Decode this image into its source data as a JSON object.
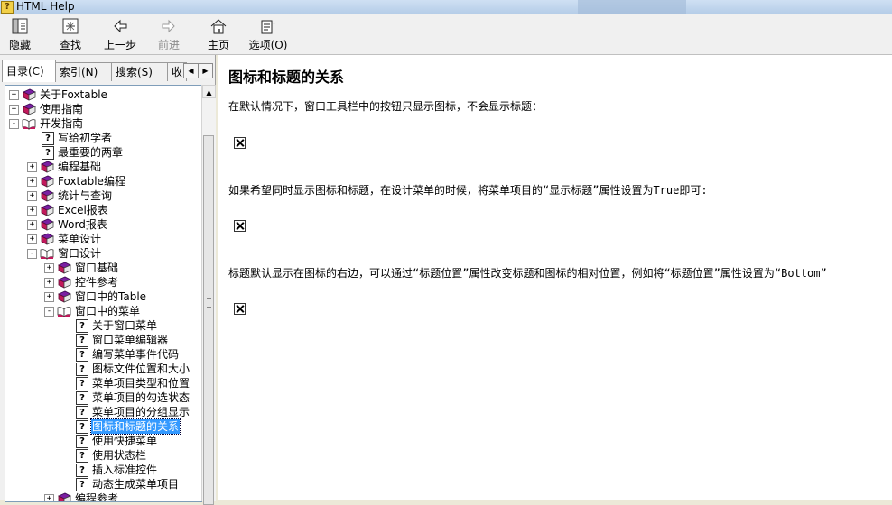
{
  "window": {
    "title": "HTML Help",
    "icon": "help-book-icon"
  },
  "toolbar": {
    "buttons": [
      {
        "label": "隐藏",
        "icon": "hide-pane-icon"
      },
      {
        "label": "查找",
        "icon": "locate-icon"
      },
      {
        "label": "上一步",
        "icon": "back-arrow-icon"
      },
      {
        "label": "前进",
        "icon": "forward-arrow-icon",
        "disabled": true
      },
      {
        "label": "主页",
        "icon": "home-icon"
      },
      {
        "label": "选项(O)",
        "icon": "options-icon"
      }
    ]
  },
  "tabs": [
    {
      "label": "目录(C)"
    },
    {
      "label": "索引(N)"
    },
    {
      "label": "搜索(S)"
    },
    {
      "label": "收"
    }
  ],
  "tree": [
    {
      "label": "关于Foxtable",
      "icon": "book-closed-icon",
      "expander": "+"
    },
    {
      "label": "使用指南",
      "icon": "book-closed-icon",
      "expander": "+"
    },
    {
      "label": "开发指南",
      "icon": "book-open-icon",
      "expander": "-"
    },
    {
      "label": "写给初学者",
      "icon": "topic-page-icon"
    },
    {
      "label": "最重要的两章",
      "icon": "topic-page-icon"
    },
    {
      "label": "编程基础",
      "icon": "book-closed-icon",
      "expander": "+"
    },
    {
      "label": "Foxtable编程",
      "icon": "book-closed-icon",
      "expander": "+"
    },
    {
      "label": "统计与查询",
      "icon": "book-closed-icon",
      "expander": "+"
    },
    {
      "label": "Excel报表",
      "icon": "book-closed-icon",
      "expander": "+"
    },
    {
      "label": "Word报表",
      "icon": "book-closed-icon",
      "expander": "+"
    },
    {
      "label": "菜单设计",
      "icon": "book-closed-icon",
      "expander": "+"
    },
    {
      "label": "窗口设计",
      "icon": "book-open-icon",
      "expander": "-"
    },
    {
      "label": "窗口基础",
      "icon": "book-closed-icon",
      "expander": "+"
    },
    {
      "label": "控件参考",
      "icon": "book-closed-icon",
      "expander": "+"
    },
    {
      "label": "窗口中的Table",
      "icon": "book-closed-icon",
      "expander": "+"
    },
    {
      "label": "窗口中的菜单",
      "icon": "book-open-icon",
      "expander": "-"
    },
    {
      "label": "关于窗口菜单",
      "icon": "topic-page-icon"
    },
    {
      "label": "窗口菜单编辑器",
      "icon": "topic-page-icon"
    },
    {
      "label": "编写菜单事件代码",
      "icon": "topic-page-icon"
    },
    {
      "label": "图标文件位置和大小",
      "icon": "topic-page-icon"
    },
    {
      "label": "菜单项目类型和位置",
      "icon": "topic-page-icon"
    },
    {
      "label": "菜单项目的勾选状态",
      "icon": "topic-page-icon"
    },
    {
      "label": "菜单项目的分组显示",
      "icon": "topic-page-icon"
    },
    {
      "label": "图标和标题的关系",
      "icon": "topic-page-icon",
      "selected": true
    },
    {
      "label": "使用快捷菜单",
      "icon": "topic-page-icon"
    },
    {
      "label": "使用状态栏",
      "icon": "topic-page-icon"
    },
    {
      "label": "插入标准控件",
      "icon": "topic-page-icon"
    },
    {
      "label": "动态生成菜单项目",
      "icon": "topic-page-icon"
    },
    {
      "label": "编程参考",
      "icon": "book-closed-icon",
      "expander": "+"
    }
  ],
  "content": {
    "title": "图标和标题的关系",
    "paragraphs": [
      "在默认情况下，窗口工具栏中的按钮只显示图标，不会显示标题：",
      "如果希望同时显示图标和标题，在设计菜单的时候，将菜单项目的“显示标题”属性设置为True即可:",
      "标题默认显示在图标的右边，可以通过“标题位置”属性改变标题和图标的相对位置，例如将“标题位置”属性设置为“Bottom”"
    ],
    "image_placeholder": "broken-image-icon"
  },
  "colors": {
    "selection": "#3399ff",
    "book": "#c2185b",
    "pane_border": "#7f9db9"
  }
}
